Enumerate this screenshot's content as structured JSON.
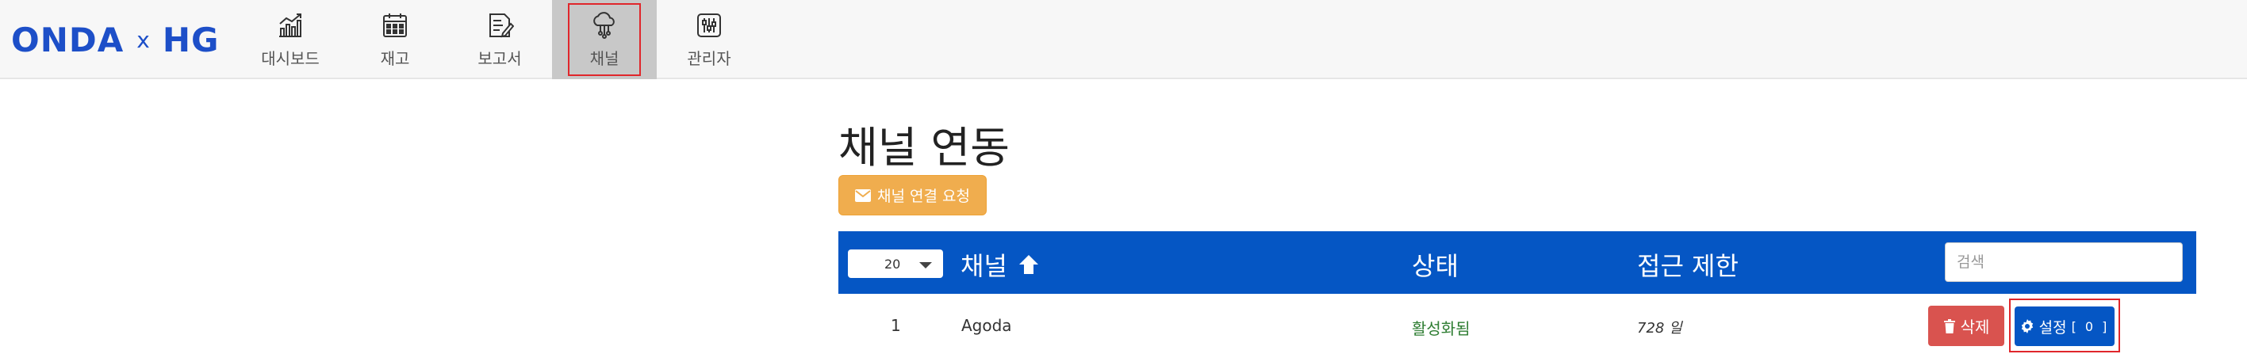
{
  "brand": {
    "left": "ONDA",
    "separator": "x",
    "right": "HG"
  },
  "nav": {
    "items": [
      {
        "label": "대시보드",
        "icon": "chart-icon"
      },
      {
        "label": "재고",
        "icon": "calendar-icon"
      },
      {
        "label": "보고서",
        "icon": "report-edit-icon"
      },
      {
        "label": "채널",
        "icon": "cloud-network-icon",
        "active": true
      },
      {
        "label": "관리자",
        "icon": "sliders-icon"
      }
    ]
  },
  "page": {
    "title": "채널 연동",
    "request_button": "채널 연결 요청"
  },
  "table": {
    "page_size": "20",
    "headers": {
      "channel": "채널",
      "status": "상태",
      "access": "접근 제한"
    },
    "search_placeholder": "검색",
    "rows": [
      {
        "no": "1",
        "name": "Agoda",
        "status": "활성화됨",
        "access": "728 일",
        "delete_label": "삭제",
        "settings_label": "설정",
        "settings_count": "[ 0 ]"
      }
    ]
  },
  "colors": {
    "brand": "#1d4fc8",
    "header_bar": "#0556c4",
    "request_button": "#f0ad4e",
    "delete_button": "#d9534f",
    "status_active": "#2e7d32",
    "highlight_box": "#e0262b"
  }
}
